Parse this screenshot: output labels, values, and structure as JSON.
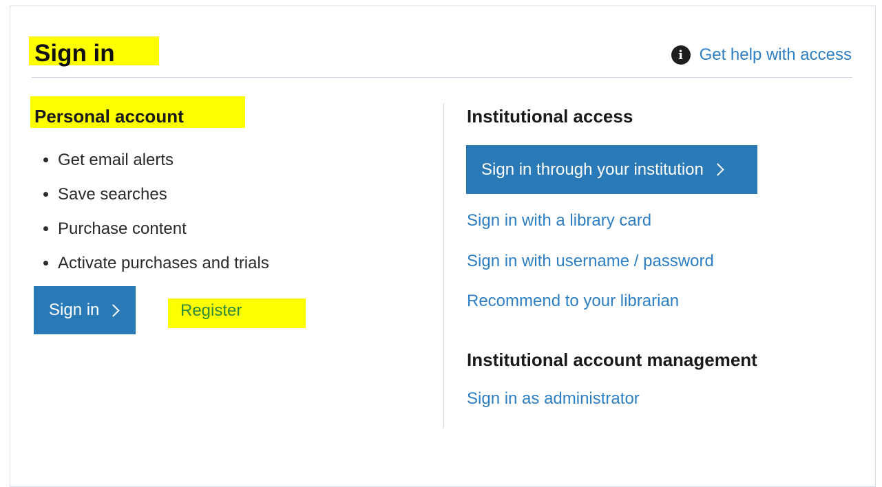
{
  "header": {
    "title": "Sign in",
    "help_link": "Get help with access",
    "help_icon": "info-icon"
  },
  "personal": {
    "heading": "Personal account",
    "benefits": [
      "Get email alerts",
      "Save searches",
      "Purchase content",
      "Activate purchases and trials"
    ],
    "signin_label": "Sign in",
    "register_label": "Register"
  },
  "institutional": {
    "heading": "Institutional access",
    "signin_institution_label": "Sign in through your institution",
    "library_card_link": "Sign in with a library card",
    "username_password_link": "Sign in with username / password",
    "recommend_link": "Recommend to your librarian"
  },
  "management": {
    "heading": "Institutional account management",
    "admin_link": "Sign in as administrator"
  },
  "colors": {
    "highlight": "#fdff00",
    "button": "#2a7ab8",
    "link": "#2d7ec2"
  }
}
